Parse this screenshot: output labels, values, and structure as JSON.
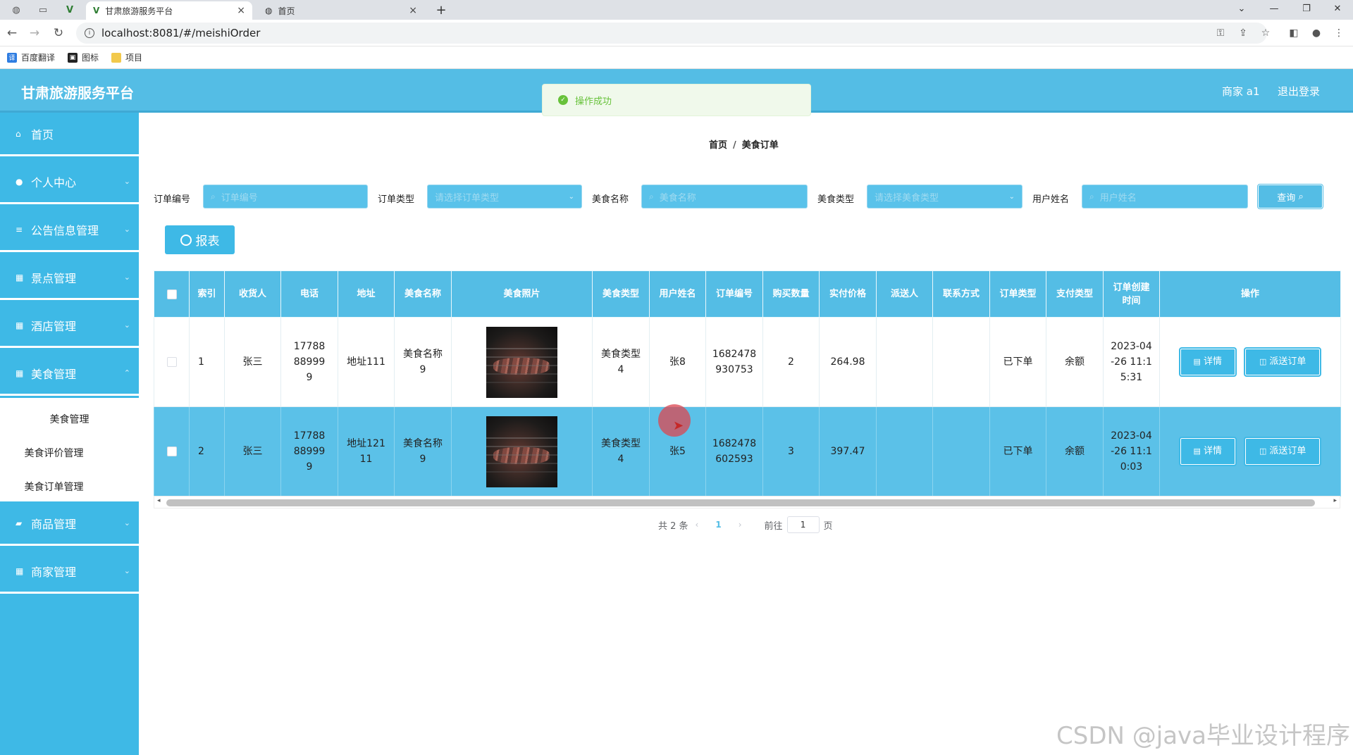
{
  "browser": {
    "tabs": [
      {
        "title": "甘肃旅游服务平台",
        "active": true
      },
      {
        "title": "首页",
        "active": false
      }
    ],
    "new_tab": "+",
    "close_glyph": "×",
    "url": "localhost:8081/#/meishiOrder",
    "bookmarks": [
      "百度翻译",
      "图标",
      "项目"
    ]
  },
  "header": {
    "title": "甘肃旅游服务平台",
    "user": "商家 a1",
    "logout": "退出登录"
  },
  "toast": {
    "message": "操作成功",
    "color": "#67c23a"
  },
  "sidebar": {
    "items": [
      {
        "label": "首页",
        "icon": "home-icon"
      },
      {
        "label": "个人中心",
        "icon": "user-icon"
      },
      {
        "label": "公告信息管理",
        "icon": "list-icon"
      },
      {
        "label": "景点管理",
        "icon": "grid-icon"
      },
      {
        "label": "酒店管理",
        "icon": "grid-icon"
      },
      {
        "label": "美食管理",
        "icon": "grid-icon"
      },
      {
        "label": "商品管理",
        "icon": "chat-icon"
      },
      {
        "label": "商家管理",
        "icon": "grid-icon"
      }
    ],
    "submenu": [
      "美食管理",
      "美食评价管理",
      "美食订单管理"
    ],
    "accent": "#3eb9e6"
  },
  "breadcrumb": {
    "home": "首页",
    "current": "美食订单",
    "separator": "/"
  },
  "search": {
    "fields": [
      {
        "label": "订单编号",
        "placeholder": "订单编号"
      },
      {
        "label": "订单类型",
        "placeholder": "请选择订单类型"
      },
      {
        "label": "美食名称",
        "placeholder": "美食名称"
      },
      {
        "label": "美食类型",
        "placeholder": "请选择美食类型"
      },
      {
        "label": "用户姓名",
        "placeholder": "用户姓名"
      }
    ],
    "query_button": "查询"
  },
  "report_button": "报表",
  "table": {
    "headers": [
      "索引",
      "收货人",
      "电话",
      "地址",
      "美食名称",
      "美食照片",
      "美食类型",
      "用户姓名",
      "订单编号",
      "购买数量",
      "实付价格",
      "派送人",
      "联系方式",
      "订单类型",
      "支付类型",
      "订单创建时间",
      "操作"
    ],
    "rows": [
      {
        "index": "1",
        "receiver": "张三",
        "phone": "17788889999",
        "address": "地址111",
        "food_name": "美食名称9",
        "food_type": "美食类型4",
        "user_name": "张8",
        "order_no": "1682478930753",
        "quantity": "2",
        "price": "264.98",
        "courier": "",
        "contact": "",
        "order_type": "已下单",
        "pay_type": "余额",
        "created": "2023-04-26 11:15:31"
      },
      {
        "index": "2",
        "receiver": "张三",
        "phone": "17788889999",
        "address": "地址12111",
        "food_name": "美食名称9",
        "food_type": "美食类型4",
        "user_name": "张5",
        "order_no": "1682478602593",
        "quantity": "3",
        "price": "397.47",
        "courier": "",
        "contact": "",
        "order_type": "已下单",
        "pay_type": "余额",
        "created": "2023-04-26 11:10:03"
      }
    ],
    "actions": {
      "detail": "详情",
      "dispatch": "派送订单"
    }
  },
  "pagination": {
    "total": "共 2 条",
    "current_page": "1",
    "goto_prefix": "前往",
    "goto_value": "1",
    "goto_suffix": "页"
  },
  "watermark": "CSDN @java毕业设计程序"
}
